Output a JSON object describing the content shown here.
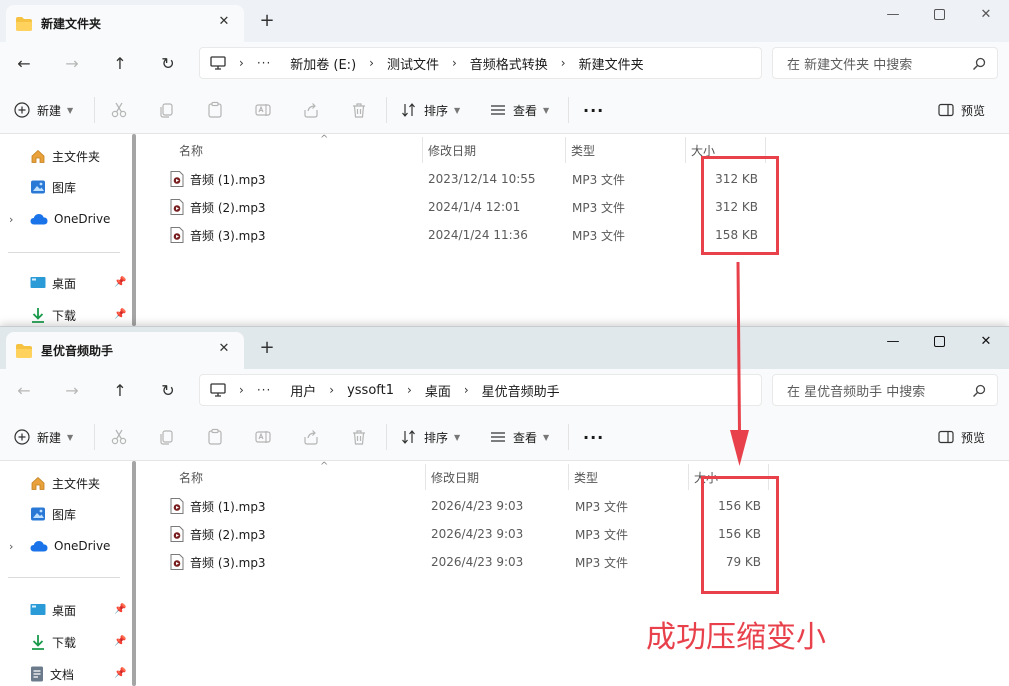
{
  "colors": {
    "accent_red": "#e8414b",
    "folder_yellow": "#f5c242",
    "onedrive_blue": "#1a73e8"
  },
  "windows": [
    {
      "tab_title": "新建文件夹",
      "path": [
        "新加卷 (E:)",
        "测试文件",
        "音频格式转换",
        "新建文件夹"
      ],
      "search_placeholder": "在 新建文件夹 中搜索",
      "sidebar": {
        "home": "主文件夹",
        "gallery": "图库",
        "onedrive": "OneDrive",
        "desktop": "桌面",
        "downloads": "下载"
      },
      "files": [
        {
          "name": "音频 (1).mp3",
          "modified": "2023/12/14 10:55",
          "type": "MP3 文件",
          "size": "312 KB"
        },
        {
          "name": "音频 (2).mp3",
          "modified": "2024/1/4 12:01",
          "type": "MP3 文件",
          "size": "312 KB"
        },
        {
          "name": "音频 (3).mp3",
          "modified": "2024/1/24 11:36",
          "type": "MP3 文件",
          "size": "158 KB"
        }
      ]
    },
    {
      "tab_title": "星优音频助手",
      "path": [
        "用户",
        "yssoft1",
        "桌面",
        "星优音频助手"
      ],
      "search_placeholder": "在 星优音频助手 中搜索",
      "sidebar": {
        "home": "主文件夹",
        "gallery": "图库",
        "onedrive": "OneDrive",
        "desktop": "桌面",
        "downloads": "下载",
        "documents": "文档"
      },
      "files": [
        {
          "name": "音频 (1).mp3",
          "modified": "2026/4/23 9:03",
          "type": "MP3 文件",
          "size": "156 KB"
        },
        {
          "name": "音频 (2).mp3",
          "modified": "2026/4/23 9:03",
          "type": "MP3 文件",
          "size": "156 KB"
        },
        {
          "name": "音频 (3).mp3",
          "modified": "2026/4/23 9:03",
          "type": "MP3 文件",
          "size": "79 KB"
        }
      ]
    }
  ],
  "toolbar": {
    "new_label": "新建",
    "sort_label": "排序",
    "view_label": "查看",
    "more_label": "···",
    "preview_label": "预览"
  },
  "columns": {
    "name": "名称",
    "modified": "修改日期",
    "type": "类型",
    "size": "大小"
  },
  "annotation": {
    "text": "成功压缩变小"
  }
}
